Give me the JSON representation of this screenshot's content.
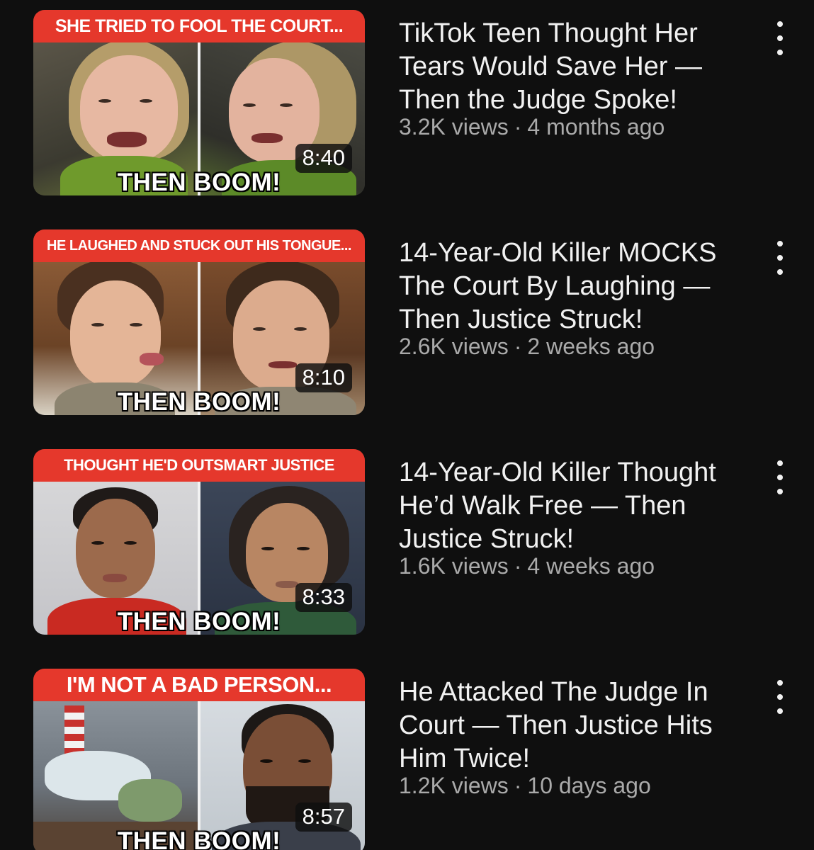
{
  "videos": [
    {
      "banner": "SHE TRIED TO FOOL THE COURT...",
      "caption": "THEN BOOM!",
      "duration": "8:40",
      "title": "TikTok Teen Thought Her Tears Would Save Her — Then the Judge Spoke!",
      "views": "3.2K views",
      "age": "4 months ago",
      "menu_icon": "more-vertical-icon"
    },
    {
      "banner": "HE LAUGHED AND STUCK OUT HIS TONGUE...",
      "caption": "THEN BOOM!",
      "duration": "8:10",
      "title": "14-Year-Old Killer MOCKS The Court By Laughing — Then Justice Struck!",
      "views": "2.6K views",
      "age": "2 weeks ago",
      "menu_icon": "more-vertical-icon"
    },
    {
      "banner": "THOUGHT HE'D OUTSMART JUSTICE",
      "caption": "THEN BOOM!",
      "duration": "8:33",
      "title": "14-Year-Old Killer Thought He’d Walk Free —  Then Justice Struck!",
      "views": "1.6K views",
      "age": "4 weeks ago",
      "menu_icon": "more-vertical-icon"
    },
    {
      "banner": "I'M NOT A BAD PERSON...",
      "caption": "THEN BOOM!",
      "duration": "8:57",
      "title": "He Attacked The Judge In Court —  Then Justice Hits Him Twice!",
      "views": "1.2K views",
      "age": "10 days ago",
      "menu_icon": "more-vertical-icon"
    }
  ],
  "colors": {
    "background": "#0f0f0f",
    "banner_red": "#e5382c",
    "title_text": "#f1f1f1",
    "meta_text": "#aaaaaa"
  }
}
